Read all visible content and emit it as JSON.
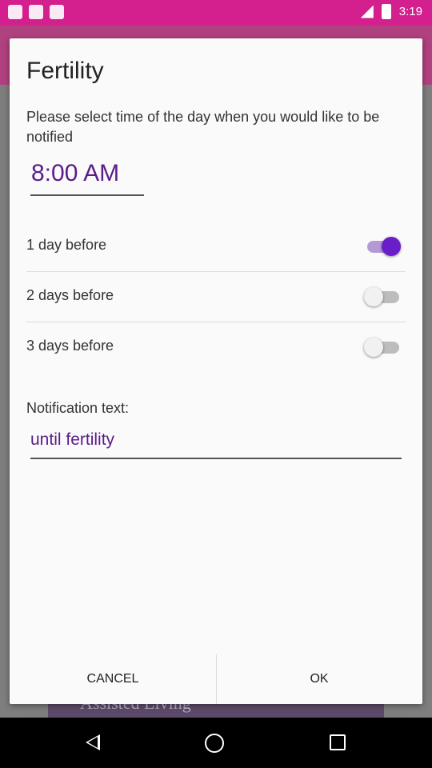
{
  "status_bar": {
    "time": "3:19"
  },
  "dialog": {
    "title": "Fertility",
    "prompt": "Please select time of the day when you would like to be notified",
    "time_value": "8:00 AM",
    "options": [
      {
        "label": "1 day before",
        "checked": true
      },
      {
        "label": "2 days before",
        "checked": false
      },
      {
        "label": "3 days before",
        "checked": false
      }
    ],
    "notification_label": "Notification text:",
    "notification_value": "until fertility",
    "cancel_label": "CANCEL",
    "ok_label": "OK"
  },
  "ad": {
    "text": "Assisted Living"
  },
  "colors": {
    "accent": "#6a1ec9",
    "status_bar": "#d41f8e"
  }
}
